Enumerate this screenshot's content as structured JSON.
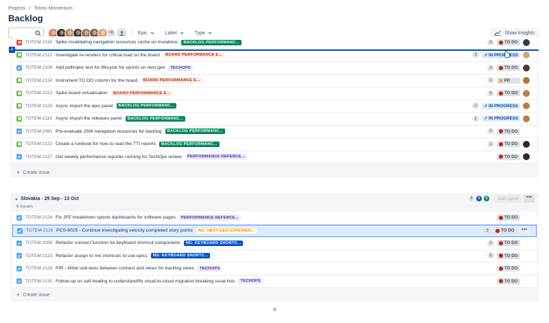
{
  "breadcrumb": {
    "root": "Projects",
    "separator": "/",
    "project": "Totoro Momentum"
  },
  "page": {
    "title": "Backlog"
  },
  "toolbar": {
    "search_value": "",
    "more_avatars": "+8",
    "filters": [
      "Epic",
      "Label",
      "Type"
    ],
    "insights_label": "Show Insights"
  },
  "colors": {
    "accent": "#0052cc",
    "todo": "#dfe1e6",
    "in_progress": "#deebff"
  },
  "avatar_colors": [
    "#d97c5b",
    "#2c2c2c",
    "#c4834f",
    "#3b3b3b",
    "#a86b4a",
    "#7a5c4d",
    "#e0a070"
  ],
  "backlog": {
    "rows": [
      {
        "key": "TOTEM-2118",
        "type": "bug",
        "summary": "Spike invalidating navigation resources cache on mutations",
        "epic": "BACKLOG PERFORMANC...",
        "epic_color": "green",
        "points": "3",
        "status": "TO DO",
        "status_kind": "todo",
        "assignee": "#3b3b3b"
      },
      {
        "key": "TOTEM-2113",
        "type": "story",
        "summary": "Investigate re-renders for critical load on the board",
        "epic": "BOARD PERFORMANCE E...",
        "epic_color": "orange",
        "points": "3",
        "status": "IN PROGRESS",
        "status_kind": "progress",
        "assignee": "#d9a37c"
      },
      {
        "key": "TOTEM-2108",
        "type": "task",
        "summary": "Add pollinator test for lifecycle for sprints on next gen",
        "epic": "TECHOPS",
        "epic_color": "purple",
        "points": "3",
        "status": "TO DO",
        "status_kind": "todo",
        "assignee": "#4a3a30"
      },
      {
        "key": "TOTEM-2114",
        "type": "story",
        "summary": "Instrument TO DO column for the board",
        "epic": "BOARD PERFORMANCE E...",
        "epic_color": "orange",
        "points": "1",
        "status": "PR",
        "status_kind": "pr",
        "assignee": "#b8733e"
      },
      {
        "key": "TOTEM-2012",
        "type": "story",
        "summary": "Spike board virtualisation",
        "epic": "BOARD PERFORMANCE E...",
        "epic_color": "orange",
        "points": "5",
        "status": "TO DO",
        "status_kind": "todo",
        "assignee": "#c27a45"
      },
      {
        "key": "TOTEM-2120",
        "type": "story",
        "summary": "Async import the epic panel",
        "epic": "BACKLOG PERFORMANC...",
        "epic_color": "green",
        "points": "2",
        "status": "IN PROGRESS",
        "status_kind": "progress",
        "assignee": "#c27a45"
      },
      {
        "key": "TOTEM-2119",
        "type": "story",
        "summary": "Async import the releases panel",
        "epic": "BACKLOG PERFORMANC...",
        "epic_color": "green",
        "points": "2",
        "status": "IN PROGRESS",
        "status_kind": "progress",
        "assignee": "#c27a45"
      },
      {
        "key": "TOTEM-2061",
        "type": "task",
        "summary": "Pre-evaluate JSW navigation resources for backlog",
        "epic": "BACKLOG PERFORMANC...",
        "epic_color": "green",
        "points": "2",
        "status": "TO DO",
        "status_kind": "todo",
        "assignee": ""
      },
      {
        "key": "TOTEM-2122",
        "type": "story",
        "summary": "Create a runbook for how to read the TTI reports",
        "epic": "BACKLOG PERFORMANC...",
        "epic_color": "green",
        "points": "1",
        "status": "TO DO",
        "status_kind": "todo",
        "assignee": "#2c2c2c"
      },
      {
        "key": "TOTEM-2127",
        "type": "task",
        "summary": "Get weekly performance reporter running for TechOps review",
        "epic": "PERFORMANCE DEFENCE...",
        "epic_color": "purple",
        "points": "",
        "status": "TO DO",
        "status_kind": "todo",
        "assignee": "#2c2c2c"
      }
    ],
    "create_label": "Create issue"
  },
  "sprint": {
    "title": "Slovakia - 29 Sep - 13 Oct",
    "issue_count": "6 issues",
    "counts": {
      "todo": "7",
      "in_progress": "0",
      "done": "0"
    },
    "start_label": "Start sprint",
    "more_label": "•••",
    "rows": [
      {
        "key": "TOTEM-2124",
        "type": "task",
        "summary": "Fix JFE breakdown splunk dashboards for software pages",
        "epic": "PERFORMANCE DEFENCE...",
        "epic_color": "purple",
        "points": "",
        "status": "TO DO",
        "status_kind": "todo",
        "assignee": ""
      },
      {
        "key": "TOTEM-2126",
        "type": "task",
        "summary": "PCS-6025 - Continue investigating velocity completed story points",
        "epic": "NG: NEXT-GEN EXPERIEN...",
        "epic_color": "amber",
        "points": "3",
        "status": "TO DO",
        "status_kind": "todo",
        "assignee": "",
        "selected": true
      },
      {
        "key": "TOTEM-2098",
        "type": "task",
        "summary": "Refactor connect function for keyboard shortcut components",
        "epic": "NG: KEYBOARD SHORTC...",
        "epic_color": "blue",
        "points": "2",
        "status": "TO DO",
        "status_kind": "todo",
        "assignee": ""
      },
      {
        "key": "TOTEM-2123",
        "type": "task",
        "summary": "Refactor assign to me shortcuts to use epics",
        "epic": "NG: KEYBOARD SHORTC...",
        "epic_color": "blue",
        "points": "2",
        "status": "TO DO",
        "status_kind": "todo",
        "assignee": ""
      },
      {
        "key": "TOTEM-2128",
        "type": "task",
        "summary": "PIR - Write unit-tests between connect and views for backlog views",
        "epic": "TECHOPS",
        "epic_color": "purple",
        "points": "",
        "status": "TO DO",
        "status_kind": "todo",
        "assignee": ""
      },
      {
        "key": "TOTEM-2130",
        "type": "task",
        "summary": "Follow-up on self-healing to understand/fix cloud-to-cloud migration breaking issue lists",
        "epic": "TECHOPS",
        "epic_color": "purple",
        "points": "",
        "status": "TO DO",
        "status_kind": "todo",
        "assignee": ""
      }
    ],
    "create_label": "Create issue"
  }
}
